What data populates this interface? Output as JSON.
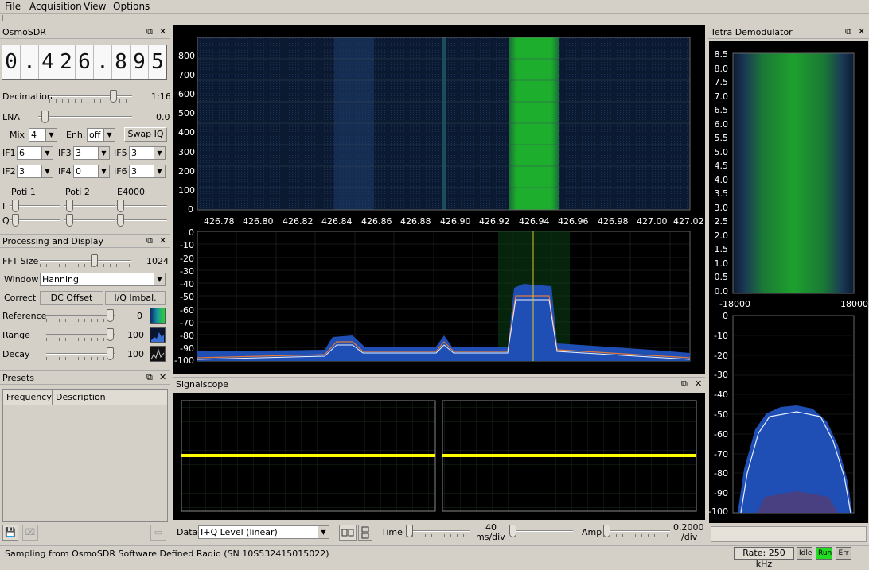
{
  "menu": {
    "file": "File",
    "acq": "Acquisition",
    "view": "View",
    "options": "Options"
  },
  "osmo": {
    "title": "OsmoSDR",
    "digits": [
      "0",
      ".",
      "4",
      "2",
      "6",
      ".",
      "8",
      "9",
      "5"
    ],
    "decimation_label": "Decimation",
    "decimation_value": "1:16",
    "decimation_level": 0.85,
    "lna_label": "LNA",
    "lna_value": "0.0",
    "lna_level": 0.05,
    "mix_label": "Mix",
    "mix_value": "4",
    "enh_label": "Enh.",
    "enh_value": "off",
    "swap": "Swap IQ",
    "if1_label": "IF1",
    "if1_value": "6",
    "if3_label": "IF3",
    "if3_value": "3",
    "if5_label": "IF5",
    "if5_value": "3",
    "if2_label": "IF2",
    "if2_value": "3",
    "if4_label": "IF4",
    "if4_value": "0",
    "if6_label": "IF6",
    "if6_value": "3",
    "poti1": "Poti 1",
    "poti2": "Poti 2",
    "e4000": "E4000",
    "i_label": "I",
    "q_label": "Q"
  },
  "proc": {
    "title": "Processing and Display",
    "fft_label": "FFT Size",
    "fft_value": "1024",
    "fft_level": 0.6,
    "window_label": "Window",
    "window_value": "Hanning",
    "correct_label": "Correct",
    "dc": "DC Offset",
    "iq": "I/Q Imbal.",
    "ref_label": "Reference",
    "ref_value": "0",
    "range_label": "Range",
    "range_value": "100",
    "decay_label": "Decay",
    "decay_value": "100"
  },
  "presets": {
    "title": "Presets",
    "col_freq": "Frequency",
    "col_desc": "Description"
  },
  "waterfall": {
    "yticks": [
      "800",
      "700",
      "600",
      "500",
      "400",
      "300",
      "200",
      "100",
      "0"
    ],
    "xticks": [
      "426.78",
      "426.80",
      "426.82",
      "426.84",
      "426.86",
      "426.88",
      "426.90",
      "426.92",
      "426.94",
      "426.96",
      "426.98",
      "427.00",
      "427.02"
    ]
  },
  "spectrum": {
    "yticks": [
      "0",
      "-10",
      "-20",
      "-30",
      "-40",
      "-50",
      "-60",
      "-70",
      "-80",
      "-90",
      "-100"
    ]
  },
  "scope": {
    "title": "Signalscope",
    "data_label": "Data",
    "data_value": "I+Q Level (linear)",
    "time_label": "Time",
    "time_value": "40",
    "time_unit": "ms/div",
    "amp_label": "Amp",
    "amp_value": "0.2000",
    "amp_unit": "/div"
  },
  "tetra": {
    "title": "Tetra Demodulator",
    "yticks": [
      "8.5",
      "8.0",
      "7.5",
      "7.0",
      "6.5",
      "6.0",
      "5.5",
      "5.0",
      "4.5",
      "4.0",
      "3.5",
      "3.0",
      "2.5",
      "2.0",
      "1.5",
      "1.0",
      "0.5",
      "0.0"
    ],
    "xmin": "-18000",
    "xmax": "18000",
    "spec_yticks": [
      "0",
      "-10",
      "-20",
      "-30",
      "-40",
      "-50",
      "-60",
      "-70",
      "-80",
      "-90",
      "-100"
    ]
  },
  "status": {
    "text": "Sampling from OsmoSDR Software Defined Radio (SN  10S532415015022)",
    "rate": "Rate: 250 kHz",
    "idle": "Idle",
    "run": "Run",
    "err": "Err"
  },
  "colors": {
    "signal_green": "#1fbf2a",
    "waterfall_bg": "#0c1a2e",
    "scope_trace": "#ffff00",
    "run_led": "#22dd22"
  }
}
